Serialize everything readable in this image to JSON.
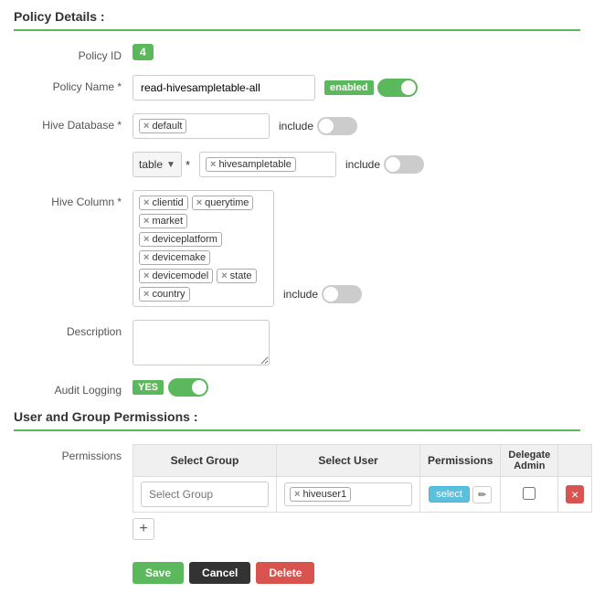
{
  "page": {
    "policy_details_title": "Policy Details :",
    "user_group_permissions_title": "User and Group Permissions :"
  },
  "policy": {
    "id": "4",
    "name": "read-hivesampletable-all",
    "enabled_label": "enabled",
    "hive_database_tag": "default",
    "table_selector": "table",
    "hive_table_tag": "hivesampletable",
    "hive_columns": [
      "clientid",
      "querytime",
      "market",
      "deviceplatform",
      "devicemake",
      "devicemodel",
      "state",
      "country"
    ],
    "description_placeholder": "",
    "audit_logging_yes": "YES",
    "include_labels": [
      "include",
      "include",
      "include"
    ]
  },
  "permissions": {
    "label": "Permissions",
    "columns": {
      "select_group": "Select Group",
      "select_user": "Select User",
      "permissions": "Permissions",
      "delegate_admin": "Delegate Admin"
    },
    "select_group_placeholder": "Select Group",
    "user_tag": "hiveuser1",
    "select_btn": "select",
    "add_btn": "+"
  },
  "buttons": {
    "save": "Save",
    "cancel": "Cancel",
    "delete": "Delete"
  }
}
